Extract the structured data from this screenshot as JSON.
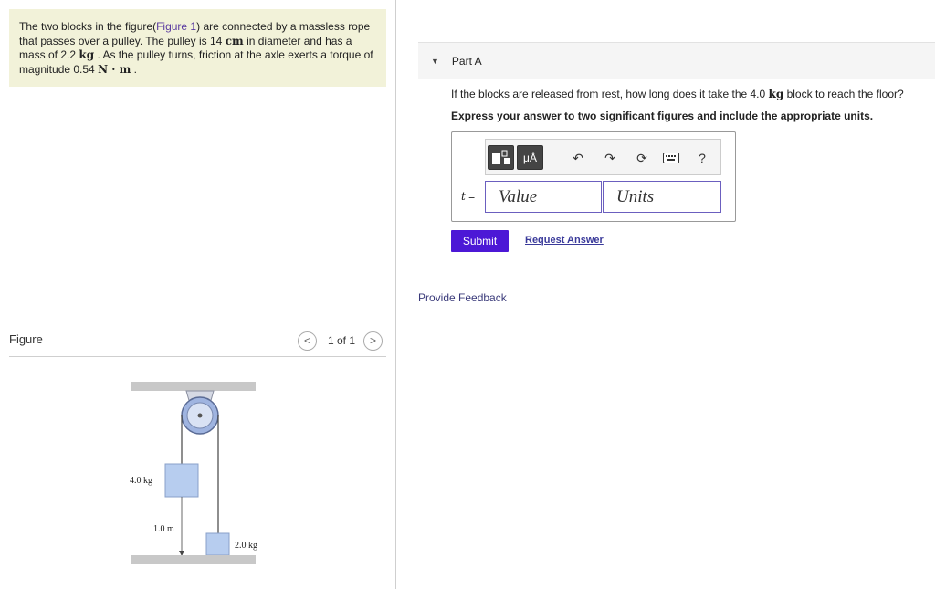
{
  "problem": {
    "line1": "The two blocks in the figure(",
    "figure_link": "Figure 1",
    "line1b": ") are connected by a massless rope",
    "line2": "that passes over a pulley. The pulley is 14",
    "unit_cm": "cm",
    "line2b": "in diameter and has a",
    "line3a": "mass of 2.2",
    "unit_kg": "kg",
    "line3b": ". As the pulley turns, friction at the axle exerts a torque of",
    "line4a": "magnitude 0.54",
    "unit_nm": "N · m",
    "line4b": "."
  },
  "figure_panel": {
    "label": "Figure",
    "pager_count": "1 of 1",
    "prev_icon": "chevron-left-icon",
    "next_icon": "chevron-right-icon",
    "prev_glyph": "<",
    "next_glyph": ">"
  },
  "figure": {
    "mass_upper": "4.0 kg",
    "mass_lower": "2.0 kg",
    "distance": "1.0 m",
    "block_color": "#b7cdef",
    "pulley_color": "#9fb4e0"
  },
  "part_a": {
    "caret": "▼",
    "title": "Part A",
    "question_a": "If the blocks are released from rest, how long does it take the 4.0",
    "question_unit": "kg",
    "question_b": "block to reach the floor?",
    "instruction": "Express your answer to two significant figures and include the appropriate units."
  },
  "answer": {
    "variable": "t",
    "equals": " =",
    "value_placeholder": "Value",
    "units_placeholder": "Units",
    "toolbar": {
      "templates_icon": "templates-icon",
      "units_label": "μÅ",
      "undo": "↶",
      "redo": "↷",
      "reset": "⟳",
      "keyboard_icon": "keyboard-icon",
      "help": "?"
    }
  },
  "actions": {
    "submit": "Submit",
    "request_answer": "Request Answer",
    "feedback": "Provide Feedback"
  },
  "colors": {
    "accent": "#4c18d6",
    "problem_bg": "#f2f2d9",
    "field_border": "#6b5fbf"
  }
}
